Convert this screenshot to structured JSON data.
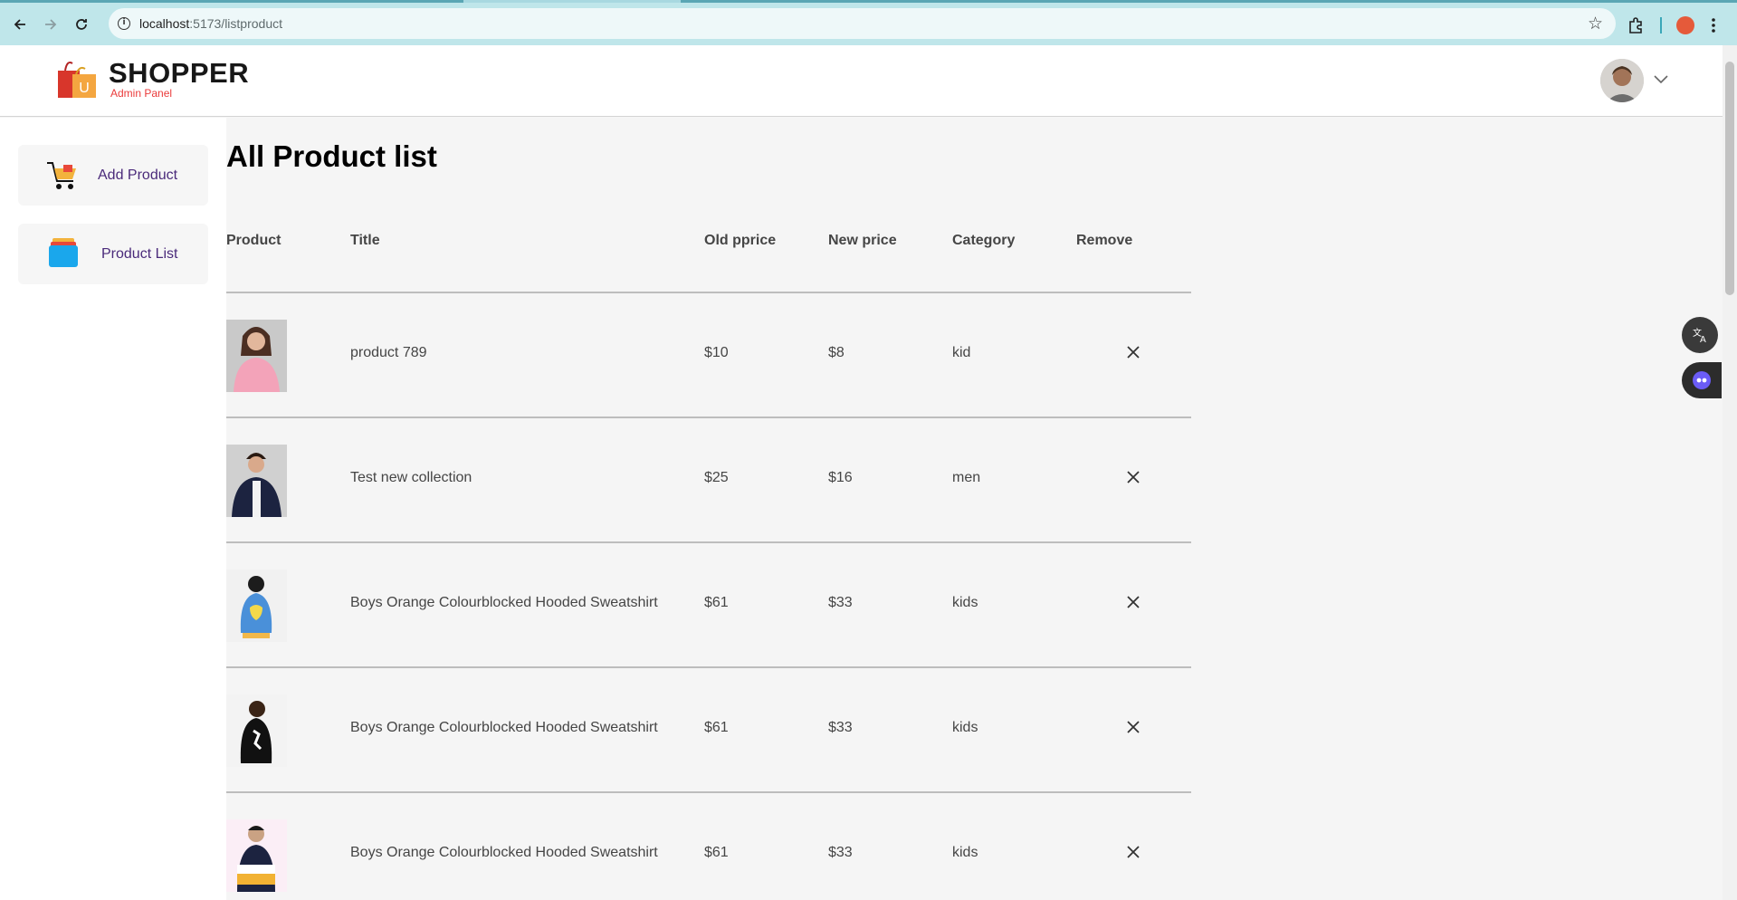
{
  "browser": {
    "url_host": "localhost",
    "url_rest": ":5173/listproduct"
  },
  "brand": {
    "title": "SHOPPER",
    "subtitle": "Admin Panel",
    "logo_letter": "U"
  },
  "sidebar": {
    "items": [
      {
        "label": "Add Product",
        "icon": "cart-icon"
      },
      {
        "label": "Product List",
        "icon": "product-list-icon"
      }
    ]
  },
  "main": {
    "title": "All Product list",
    "columns": [
      "Product",
      "Title",
      "Old pprice",
      "New price",
      "Category",
      "Remove"
    ],
    "rows": [
      {
        "title": "product 789",
        "old_price": "$10",
        "new_price": "$8",
        "category": "kid"
      },
      {
        "title": "Test new collection",
        "old_price": "$25",
        "new_price": "$16",
        "category": "men"
      },
      {
        "title": "Boys Orange Colourblocked Hooded Sweatshirt",
        "old_price": "$61",
        "new_price": "$33",
        "category": "kids"
      },
      {
        "title": "Boys Orange Colourblocked Hooded Sweatshirt",
        "old_price": "$61",
        "new_price": "$33",
        "category": "kids"
      },
      {
        "title": "Boys Orange Colourblocked Hooded Sweatshirt",
        "old_price": "$61",
        "new_price": "$33",
        "category": "kids"
      }
    ]
  },
  "colors": {
    "chrome": "#bfe6ea",
    "brand_red": "#ea3a3a",
    "sidebar_label": "#4a2a7a",
    "page_bg": "#f5f5f5"
  }
}
